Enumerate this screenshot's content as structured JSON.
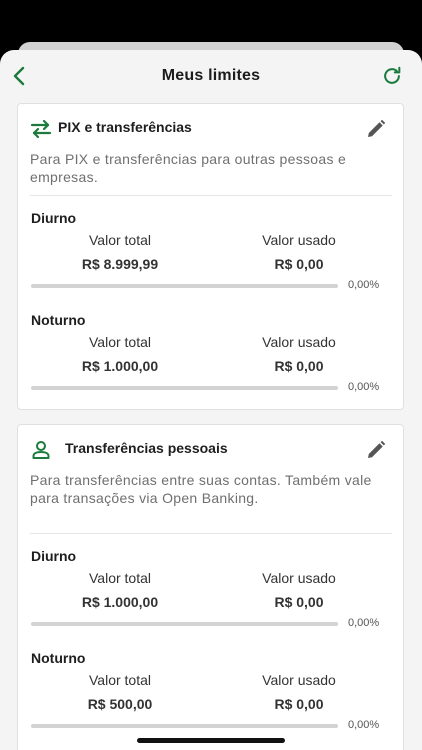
{
  "header": {
    "title": "Meus limites",
    "back_icon": "chevron-left-icon",
    "refresh_icon": "refresh-icon"
  },
  "colors": {
    "accent": "#1b7a3c",
    "background": "#f4f4f4",
    "card": "#ffffff"
  },
  "cards": [
    {
      "title": "PIX e transferências",
      "icon": "arrows-swap-icon",
      "edit_icon": "pencil-icon",
      "description": "Para PIX e transferências para outras pessoas e empresas.",
      "periods": [
        {
          "label": "Diurno",
          "total_label": "Valor total",
          "total_value": "R$ 8.999,99",
          "used_label": "Valor usado",
          "used_value": "R$ 0,00",
          "percent_text": "0,00%",
          "percent": 0
        },
        {
          "label": "Noturno",
          "total_label": "Valor total",
          "total_value": "R$ 1.000,00",
          "used_label": "Valor usado",
          "used_value": "R$ 0,00",
          "percent_text": "0,00%",
          "percent": 0
        }
      ]
    },
    {
      "title": "Transferências pessoais",
      "icon": "person-icon",
      "edit_icon": "pencil-icon",
      "description": "Para transferências entre suas contas. Também vale para transações via Open Banking.",
      "periods": [
        {
          "label": "Diurno",
          "total_label": "Valor total",
          "total_value": "R$ 1.000,00",
          "used_label": "Valor usado",
          "used_value": "R$ 0,00",
          "percent_text": "0,00%",
          "percent": 0
        },
        {
          "label": "Noturno",
          "total_label": "Valor total",
          "total_value": "R$ 500,00",
          "used_label": "Valor usado",
          "used_value": "R$ 0,00",
          "percent_text": "0,00%",
          "percent": 0
        }
      ]
    }
  ]
}
